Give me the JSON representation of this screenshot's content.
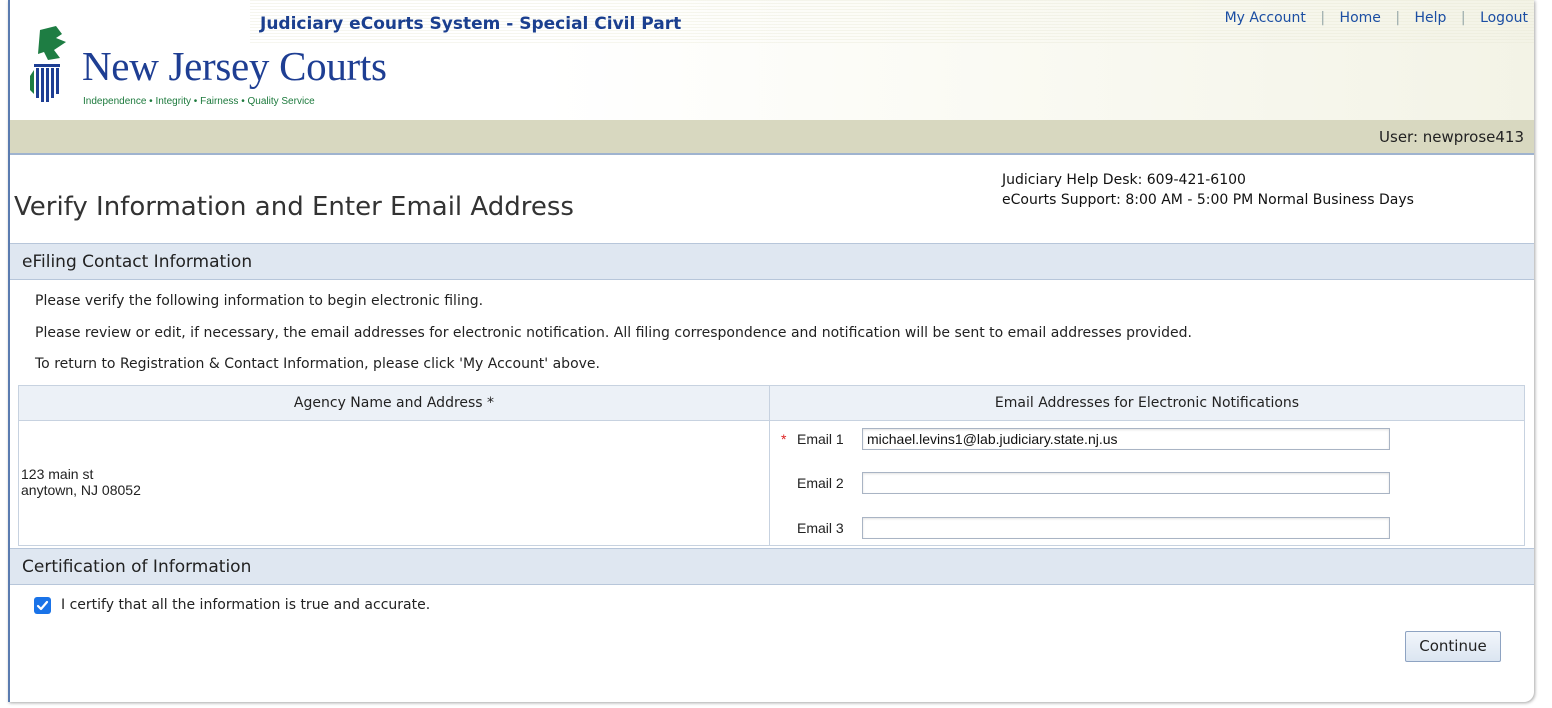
{
  "header": {
    "system_title": "Judiciary eCourts System - Special Civil Part",
    "nav": {
      "my_account": "My Account",
      "home": "Home",
      "help": "Help",
      "logout": "Logout",
      "separator": "|"
    },
    "logo": {
      "title": "New Jersey Courts",
      "tagline": "Independence • Integrity • Fairness • Quality Service"
    },
    "user": "User: newprose413"
  },
  "page": {
    "title": "Verify Information and Enter Email Address",
    "helpdesk_line1": "Judiciary Help Desk: 609-421-6100",
    "helpdesk_line2": "eCourts Support: 8:00 AM - 5:00 PM Normal Business Days"
  },
  "contact_section": {
    "header": "eFiling Contact Information",
    "instructions": [
      "Please verify the following information to begin electronic filing.",
      "Please review or edit, if necessary, the email addresses for electronic notification. All filing correspondence and notification will be sent to email addresses provided.",
      "To return to Registration & Contact Information, please click 'My Account' above."
    ],
    "table": {
      "col_agency": "Agency Name and Address *",
      "col_email": "Email Addresses for Electronic Notifications",
      "address_line1": "123 main st",
      "address_line2": "anytown, NJ 08052",
      "required_marker": "*",
      "emails": [
        {
          "label": "Email 1",
          "value": "michael.levins1@lab.judiciary.state.nj.us"
        },
        {
          "label": "Email 2",
          "value": ""
        },
        {
          "label": "Email 3",
          "value": ""
        }
      ]
    }
  },
  "certification": {
    "header": "Certification of Information",
    "checkbox_label": "I certify that all the information is true and accurate.",
    "checked": true,
    "continue_label": "Continue"
  },
  "colors": {
    "brand_blue": "#1e3e93",
    "link_blue": "#1b4ea3",
    "section_bg": "#dfe7f1",
    "userbar_bg": "#d8d8c0",
    "checkbox_blue": "#1a73e8"
  }
}
